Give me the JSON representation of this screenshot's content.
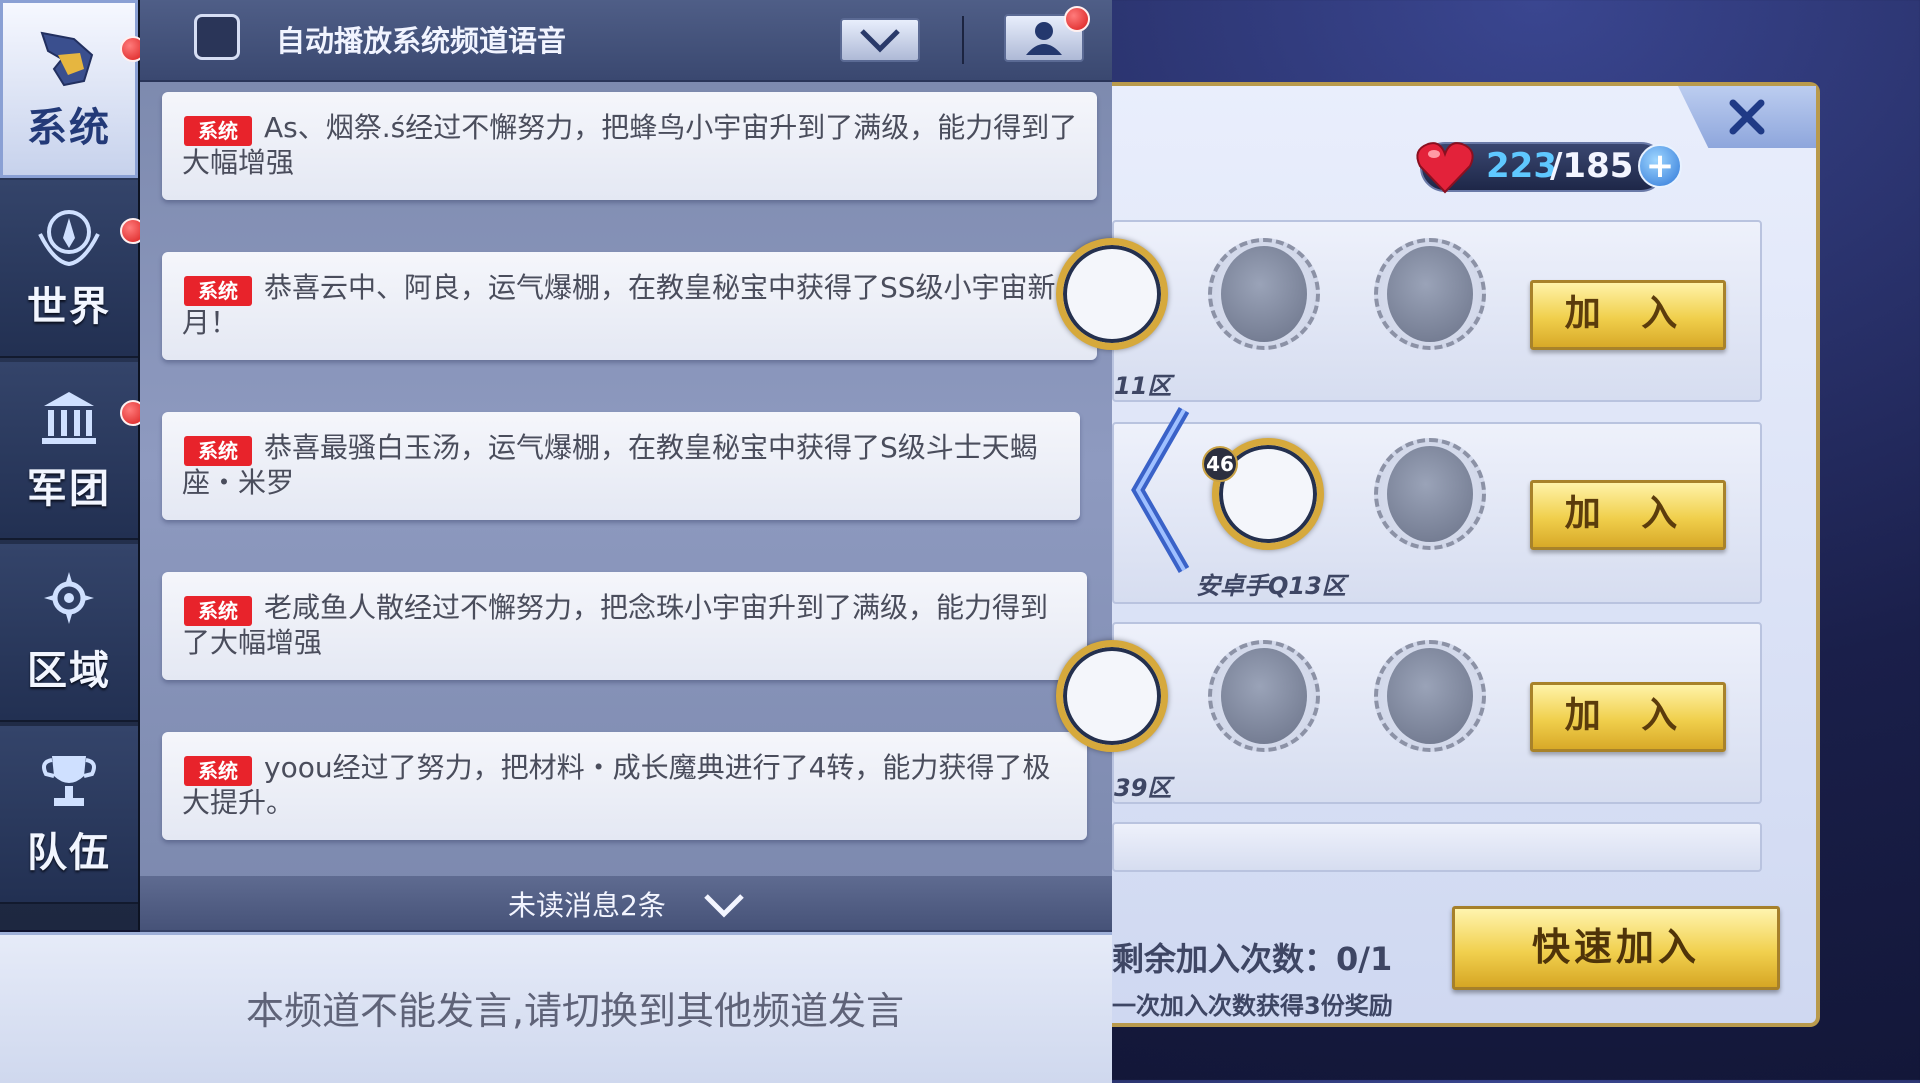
{
  "tabs": [
    {
      "label": "系统",
      "icon": "helmet-icon",
      "active": true
    },
    {
      "label": "世界",
      "icon": "globe-emblem-icon",
      "active": false
    },
    {
      "label": "军团",
      "icon": "temple-icon",
      "active": false
    },
    {
      "label": "区域",
      "icon": "gear-star-icon",
      "active": false
    },
    {
      "label": "队伍",
      "icon": "trophy-icon",
      "active": false
    }
  ],
  "chat_header": {
    "autoplay_label": "自动播放系统频道语音",
    "autoplay_checked": false
  },
  "messages": [
    {
      "tag": "系统",
      "text": "As、烟祭.ś经过不懈努力，把蜂鸟小宇宙升到了满级，能力得到了大幅增强"
    },
    {
      "tag": "系统",
      "text": "恭喜云中、阿良，运气爆棚，在教皇秘宝中获得了SS级小宇宙新月！"
    },
    {
      "tag": "系统",
      "text": "恭喜最骚白玉汤，运气爆棚，在教皇秘宝中获得了S级斗士天蝎座・米罗"
    },
    {
      "tag": "系统",
      "text": "老咸鱼人散经过不懈努力，把念珠小宇宙升到了满级，能力得到了大幅增强"
    },
    {
      "tag": "系统",
      "text": "yoou经过了努力，把材料・成长魔典进行了4转，能力获得了极大提升。"
    }
  ],
  "unread": {
    "label": "未读消息2条"
  },
  "input_bar": {
    "notice": "本频道不能发言,请切换到其他频道发言"
  },
  "team_panel": {
    "stamina_current": "223",
    "stamina_max": "/185",
    "teams": [
      {
        "server": "11区",
        "join_label": "加 入"
      },
      {
        "server": "安卓手Q13区",
        "level": "46",
        "join_label": "加 入"
      },
      {
        "server": "39区",
        "join_label": "加 入"
      }
    ],
    "remaining_label": "剩余加入次数：0/1",
    "reward_hint": "一次加入次数获得3份奖励",
    "quick_join_label": "快速加入"
  },
  "colors": {
    "accent_gold": "#f0cf4c",
    "system_tag_red": "#e8232b",
    "stamina_blue": "#5fc8ff"
  }
}
